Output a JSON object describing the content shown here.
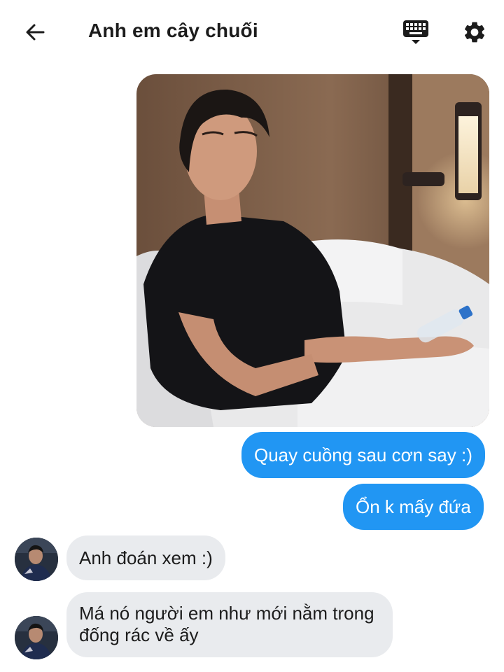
{
  "header": {
    "title": "Anh em cây chuối",
    "back_icon": "back-arrow-icon",
    "keyboard_icon": "keyboard-icon",
    "settings_icon": "gear-icon"
  },
  "messages": [
    {
      "side": "outgoing",
      "type": "image"
    },
    {
      "side": "outgoing",
      "type": "text",
      "text": "Quay cuồng sau cơn say :)"
    },
    {
      "side": "outgoing",
      "type": "text",
      "text": "Ổn k mấy đứa"
    },
    {
      "side": "incoming",
      "type": "text",
      "text": "Anh đoán xem :)"
    },
    {
      "side": "incoming",
      "type": "text",
      "text": "Má nó người em như mới nằm trong đống rác về ấy"
    }
  ],
  "colors": {
    "outgoing_bubble": "#2196f3",
    "incoming_bubble": "#e9ebee",
    "title_text": "#1c1c1c"
  }
}
